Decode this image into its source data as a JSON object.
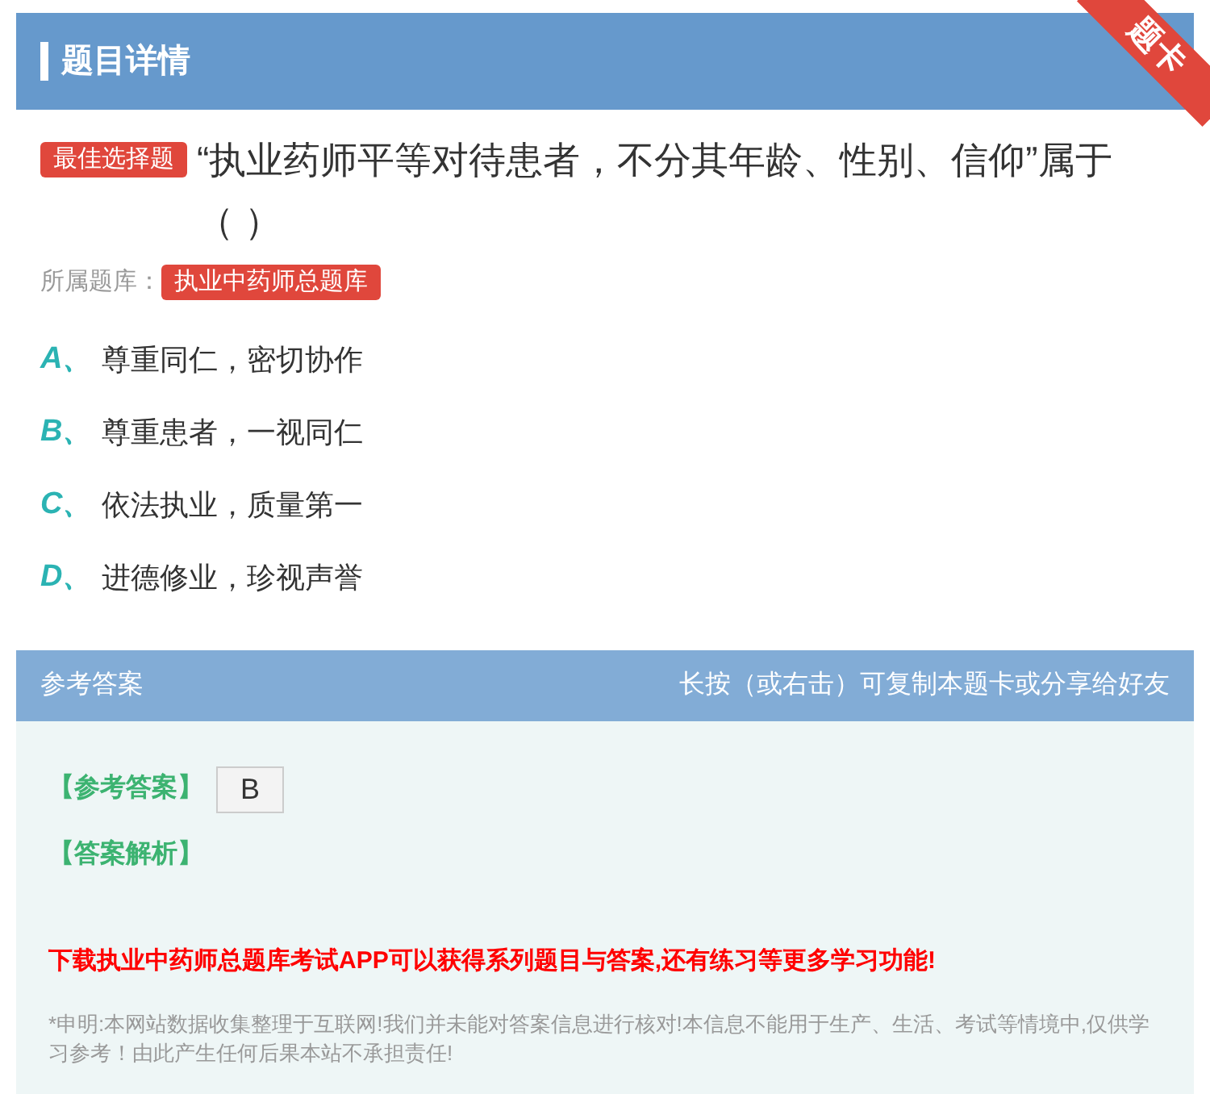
{
  "header": {
    "title": "题目详情",
    "ribbon": "题卡"
  },
  "question": {
    "type_badge": "最佳选择题",
    "text": "“执业药师平等对待患者，不分其年龄、性别、信仰”属于（ ）",
    "bank_label": "所属题库：",
    "bank": "执业中药师总题库"
  },
  "options": [
    {
      "letter": "A、",
      "text": "尊重同仁，密切协作"
    },
    {
      "letter": "B、",
      "text": "尊重患者，一视同仁"
    },
    {
      "letter": "C、",
      "text": "依法执业，质量第一"
    },
    {
      "letter": "D、",
      "text": "进德修业，珍视声誉"
    }
  ],
  "answer_panel": {
    "title": "参考答案",
    "hint": "长按（或右击）可复制本题卡或分享给好友",
    "answer_label": "【参考答案】",
    "answer": "B",
    "analysis_label": "【答案解析】",
    "promo": "下载执业中药师总题库考试APP可以获得系列题目与答案,还有练习等更多学习功能!",
    "disclaimer": "*申明:本网站数据收集整理于互联网!我们并未能对答案信息进行核对!本信息不能用于生产、生活、考试等情境中,仅供学习参考！由此产生任何后果本站不承担责任!"
  }
}
